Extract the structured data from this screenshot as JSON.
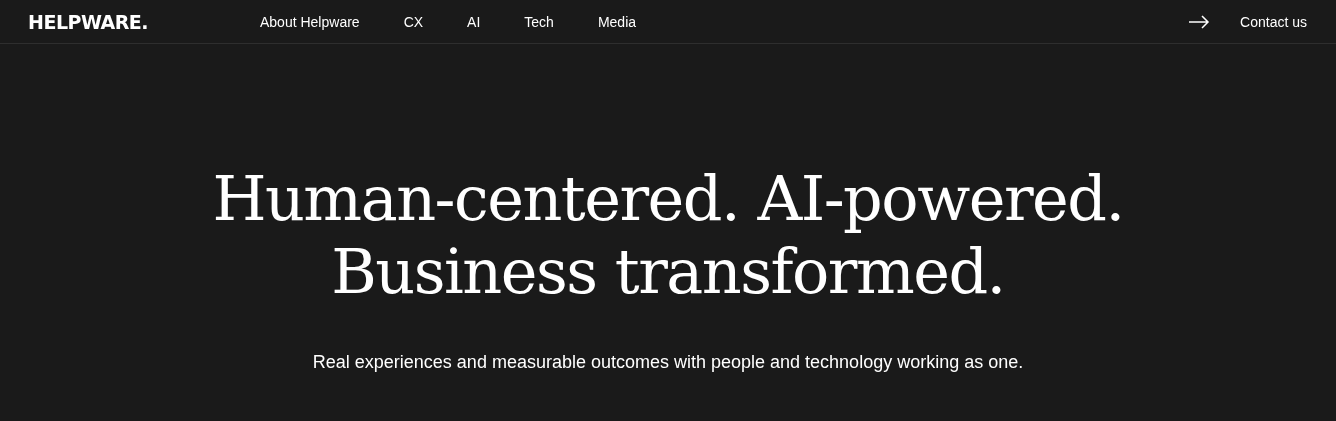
{
  "header": {
    "logo": "HELPWARE.",
    "nav": [
      "About Helpware",
      "CX",
      "AI",
      "Tech",
      "Media"
    ],
    "contact": "Contact us"
  },
  "hero": {
    "headline": [
      "Human-centered. AI-powered.",
      "Business transformed."
    ],
    "subtitle": "Real experiences and measurable outcomes with people and technology working as one."
  }
}
